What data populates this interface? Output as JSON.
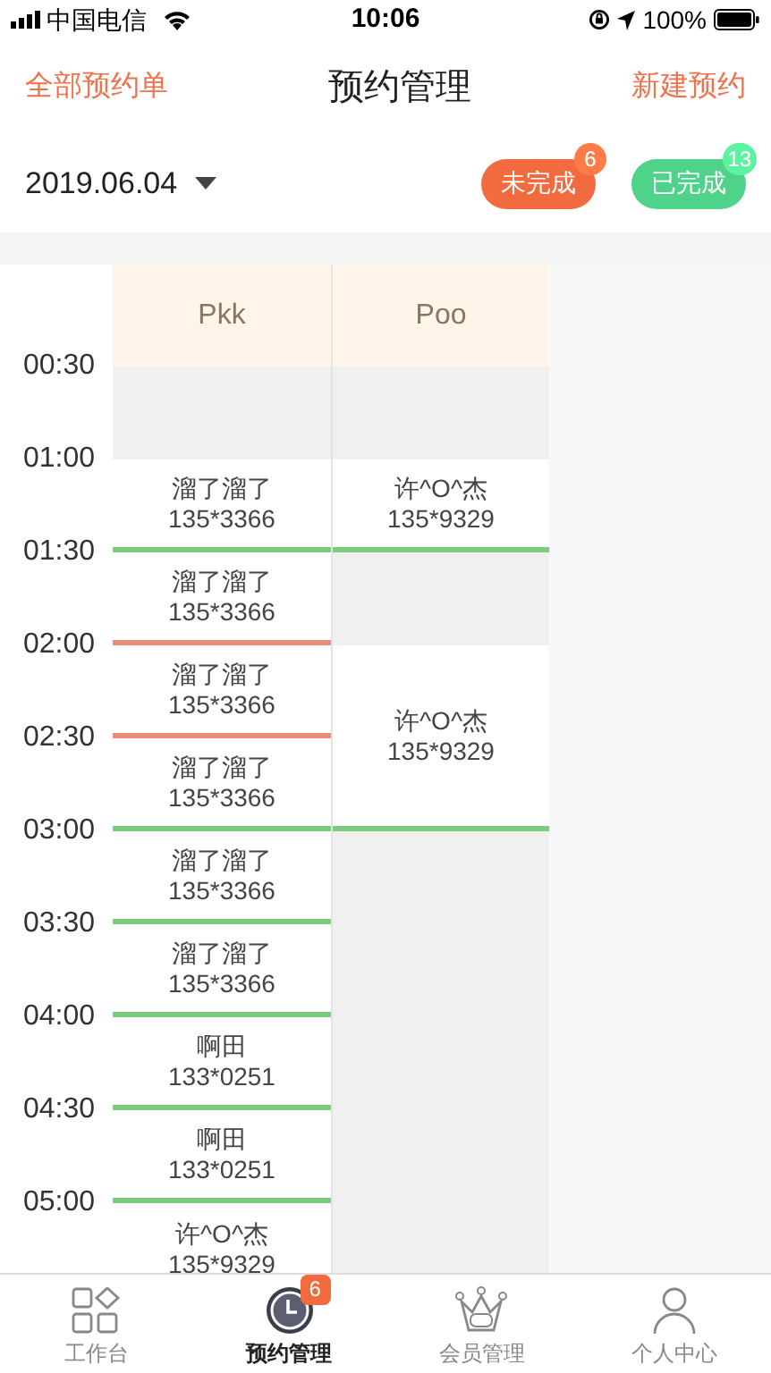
{
  "status_bar": {
    "carrier": "中国电信",
    "time": "10:06",
    "battery": "100%"
  },
  "header": {
    "left_link": "全部预约单",
    "title": "预约管理",
    "right_link": "新建预约"
  },
  "date_picker": {
    "value": "2019.06.04"
  },
  "filters": [
    {
      "label": "未完成",
      "count": "6",
      "color": "#f26b3f"
    },
    {
      "label": "已完成",
      "count": "13",
      "color": "#4fd38a"
    }
  ],
  "schedule": {
    "times": [
      "00:30",
      "01:00",
      "01:30",
      "02:00",
      "02:30",
      "03:00",
      "03:30",
      "04:00",
      "04:30",
      "05:00"
    ],
    "columns": [
      {
        "name": "Pkk",
        "cells": [
          {
            "kind": "empty"
          },
          {
            "kind": "single",
            "name": "溜了溜了",
            "phone": "135*3366",
            "color": "#7dcb7d"
          },
          {
            "kind": "single",
            "name": "溜了溜了",
            "phone": "135*3366",
            "color": "#ec8c7a"
          },
          {
            "kind": "single",
            "name": "溜了溜了",
            "phone": "135*3366",
            "color": "#ec8c7a"
          },
          {
            "kind": "single",
            "name": "溜了溜了",
            "phone": "135*3366",
            "color": "#7dcb7d"
          },
          {
            "kind": "single",
            "name": "溜了溜了",
            "phone": "135*3366",
            "color": "#7dcb7d"
          },
          {
            "kind": "single",
            "name": "溜了溜了",
            "phone": "135*3366",
            "color": "#7dcb7d"
          },
          {
            "kind": "single",
            "name": "啊田",
            "phone": "133*0251",
            "color": "#7dcb7d"
          },
          {
            "kind": "single",
            "name": "啊田",
            "phone": "133*0251",
            "color": "#7dcb7d"
          },
          {
            "kind": "single",
            "name": "许^O^杰",
            "phone": "135*9329"
          }
        ]
      },
      {
        "name": "Poo",
        "cells": [
          {
            "kind": "empty"
          },
          {
            "kind": "single",
            "name": "许^O^杰",
            "phone": "135*9329",
            "color": "#7dcb7d"
          },
          {
            "kind": "empty"
          },
          {
            "kind": "double",
            "name": "许^O^杰",
            "phone": "135*9329",
            "color": "#7dcb7d"
          }
        ]
      }
    ]
  },
  "tab_bar": [
    {
      "kind": "workbench",
      "label": "工作台",
      "selected": false
    },
    {
      "kind": "clock",
      "label": "预约管理",
      "selected": true,
      "badge": "6"
    },
    {
      "kind": "vip",
      "label": "会员管理",
      "selected": false
    },
    {
      "kind": "person",
      "label": "个人中心",
      "selected": false
    }
  ]
}
